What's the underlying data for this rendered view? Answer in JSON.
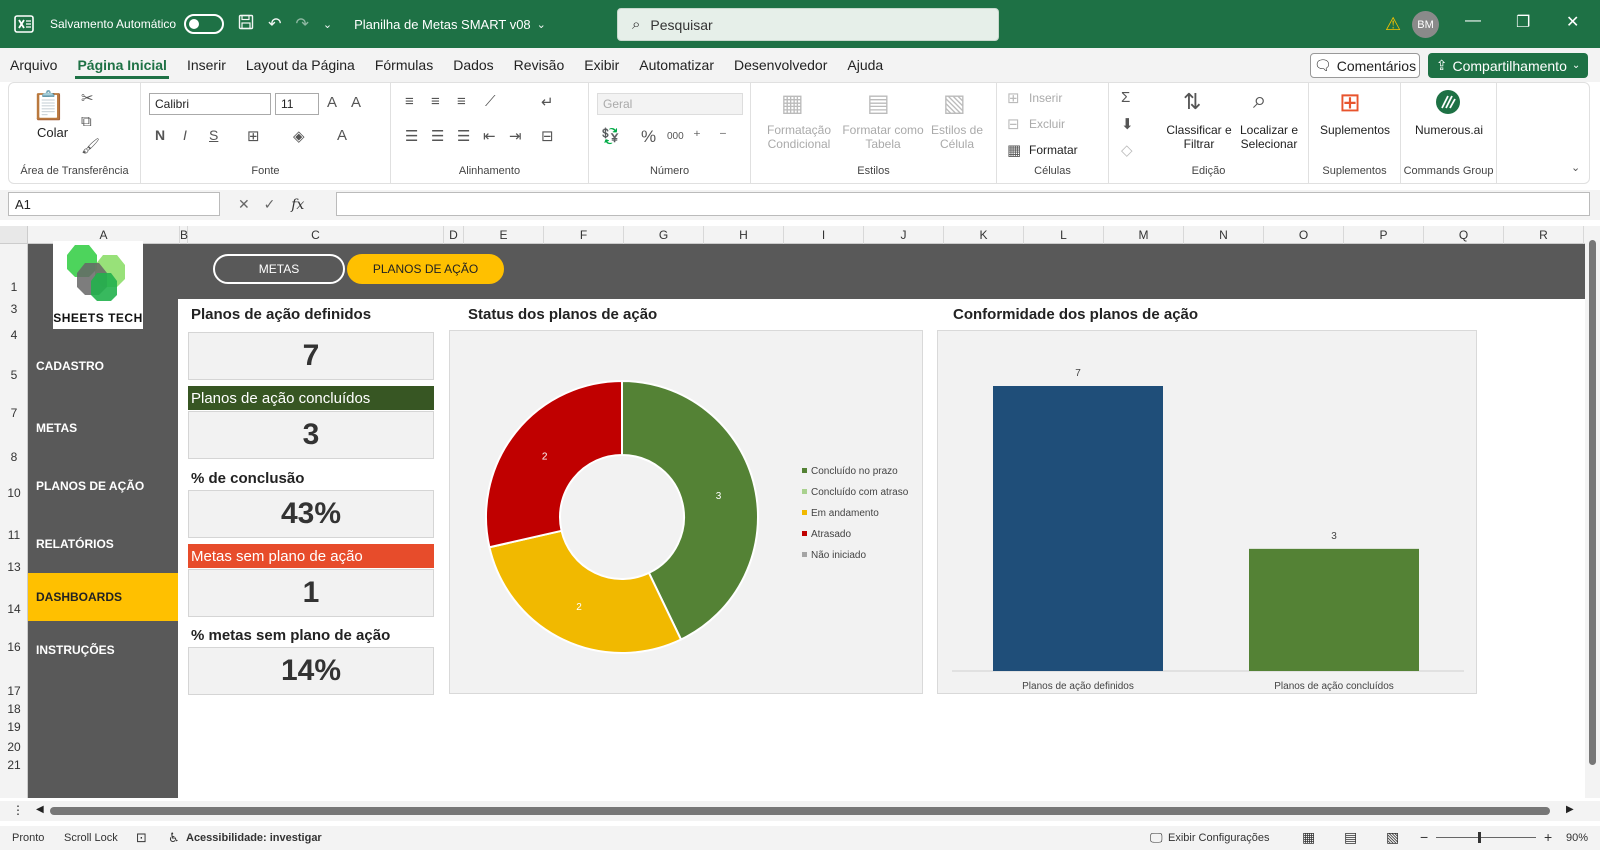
{
  "titlebar": {
    "autosave_label": "Salvamento Automático",
    "doc_title": "Planilha de Metas SMART v08",
    "search_placeholder": "Pesquisar",
    "avatar_initials": "BM"
  },
  "menu": {
    "items": [
      "Arquivo",
      "Página Inicial",
      "Inserir",
      "Layout da Página",
      "Fórmulas",
      "Dados",
      "Revisão",
      "Exibir",
      "Automatizar",
      "Desenvolvedor",
      "Ajuda"
    ],
    "active": "Página Inicial",
    "comments": "Comentários",
    "share": "Compartilhamento"
  },
  "ribbon": {
    "clipboard": {
      "paste": "Colar",
      "label": "Área de Transferência"
    },
    "font": {
      "name": "Calibri",
      "size": "11",
      "label": "Fonte",
      "bold": "N",
      "italic": "I",
      "underline": "S"
    },
    "alignment": {
      "label": "Alinhamento"
    },
    "number": {
      "format": "Geral",
      "percent": "%",
      "thousands": "000",
      "label": "Número"
    },
    "styles": {
      "conditional": "Formatação Condicional",
      "table": "Formatar como Tabela",
      "cell": "Estilos de Célula",
      "label": "Estilos"
    },
    "cells": {
      "insert": "Inserir",
      "delete": "Excluir",
      "format": "Formatar",
      "label": "Células"
    },
    "editing": {
      "sort": "Classificar e Filtrar",
      "find": "Localizar e Selecionar",
      "label": "Edição"
    },
    "addins": {
      "name": "Suplementos",
      "label": "Suplementos"
    },
    "numerous": {
      "name": "Numerous.ai",
      "label": "Commands Group"
    }
  },
  "formula": {
    "cell_ref": "A1",
    "fx": "fx"
  },
  "sheet": {
    "columns": [
      "A",
      "B",
      "C",
      "D",
      "E",
      "F",
      "G",
      "H",
      "I",
      "J",
      "K",
      "L",
      "M",
      "N",
      "O",
      "P",
      "Q",
      "R"
    ],
    "rows": [
      "1",
      "3",
      "4",
      "5",
      "7",
      "8",
      "10",
      "11",
      "13",
      "14",
      "16",
      "17",
      "18",
      "19",
      "20",
      "21"
    ]
  },
  "dashboard": {
    "logo_text": "SHEETS TECH",
    "tabs": {
      "metas": "METAS",
      "planos": "PLANOS DE AÇÃO"
    },
    "nav": [
      "CADASTRO",
      "METAS",
      "PLANOS DE AÇÃO",
      "RELATÓRIOS",
      "DASHBOARDS",
      "INSTRUÇÕES"
    ],
    "nav_active": "DASHBOARDS",
    "kpis": {
      "defined_label": "Planos de ação definidos",
      "defined_value": "7",
      "done_label": "Planos de ação concluídos",
      "done_value": "3",
      "pct_label": "% de conclusão",
      "pct_value": "43%",
      "no_plan_label": "Metas sem plano de ação",
      "no_plan_value": "1",
      "pct_no_plan_label": "% metas sem plano de ação",
      "pct_no_plan_value": "14%"
    },
    "colors": {
      "green_dark": "#375623",
      "red": "#e74c2b",
      "yellow": "#ffc000",
      "grey": "#595959"
    }
  },
  "chart_data": [
    {
      "type": "pie",
      "title": "Status dos planos de ação",
      "categories": [
        "Concluído no prazo",
        "Concluído com atraso",
        "Em andamento",
        "Atrasado",
        "Não iniciado"
      ],
      "values": [
        3,
        0,
        2,
        2,
        0
      ],
      "colors": [
        "#548235",
        "#a9d18e",
        "#f1b900",
        "#c00000",
        "#a5a5a5"
      ],
      "legend": "right"
    },
    {
      "type": "bar",
      "title": "Conformidade dos planos de ação",
      "categories": [
        "Planos de ação definidos",
        "Planos de ação concluídos"
      ],
      "values": [
        7,
        3
      ],
      "colors": [
        "#1f4e79",
        "#548235"
      ],
      "ylim": [
        0,
        7
      ]
    }
  ],
  "status": {
    "ready": "Pronto",
    "scroll_lock": "Scroll Lock",
    "accessibility": "Acessibilidade: investigar",
    "display_settings": "Exibir Configurações",
    "zoom": "90%"
  }
}
